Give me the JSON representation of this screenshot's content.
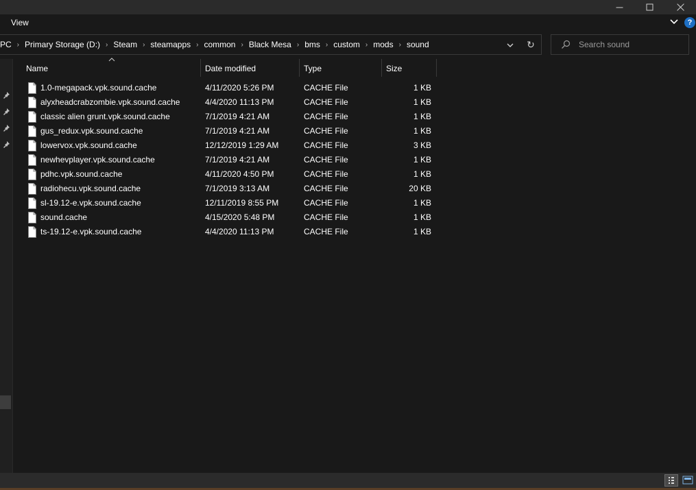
{
  "ribbon": {
    "view_tab": "View"
  },
  "address": {
    "crumbs": [
      "PC",
      "Primary Storage (D:)",
      "Steam",
      "steamapps",
      "common",
      "Black Mesa",
      "bms",
      "custom",
      "mods",
      "sound"
    ]
  },
  "search": {
    "placeholder": "Search sound"
  },
  "columns": {
    "name": "Name",
    "date": "Date modified",
    "type": "Type",
    "size": "Size"
  },
  "files": [
    {
      "name": "1.0-megapack.vpk.sound.cache",
      "date": "4/11/2020 5:26 PM",
      "type": "CACHE File",
      "size": "1 KB"
    },
    {
      "name": "alyxheadcrabzombie.vpk.sound.cache",
      "date": "4/4/2020 11:13 PM",
      "type": "CACHE File",
      "size": "1 KB"
    },
    {
      "name": "classic alien grunt.vpk.sound.cache",
      "date": "7/1/2019 4:21 AM",
      "type": "CACHE File",
      "size": "1 KB"
    },
    {
      "name": "gus_redux.vpk.sound.cache",
      "date": "7/1/2019 4:21 AM",
      "type": "CACHE File",
      "size": "1 KB"
    },
    {
      "name": "lowervox.vpk.sound.cache",
      "date": "12/12/2019 1:29 AM",
      "type": "CACHE File",
      "size": "3 KB"
    },
    {
      "name": "newhevplayer.vpk.sound.cache",
      "date": "7/1/2019 4:21 AM",
      "type": "CACHE File",
      "size": "1 KB"
    },
    {
      "name": "pdhc.vpk.sound.cache",
      "date": "4/11/2020 4:50 PM",
      "type": "CACHE File",
      "size": "1 KB"
    },
    {
      "name": "radiohecu.vpk.sound.cache",
      "date": "7/1/2019 3:13 AM",
      "type": "CACHE File",
      "size": "20 KB"
    },
    {
      "name": "sl-19.12-e.vpk.sound.cache",
      "date": "12/11/2019 8:55 PM",
      "type": "CACHE File",
      "size": "1 KB"
    },
    {
      "name": "sound.cache",
      "date": "4/15/2020 5:48 PM",
      "type": "CACHE File",
      "size": "1 KB"
    },
    {
      "name": "ts-19.12-e.vpk.sound.cache",
      "date": "4/4/2020 11:13 PM",
      "type": "CACHE File",
      "size": "1 KB"
    }
  ],
  "colors": {
    "background": "#191919",
    "chrome": "#2b2b2b",
    "help_blue": "#1e6fc4",
    "border": "#3a3a3a"
  },
  "icons": [
    "minimize-icon",
    "maximize-icon",
    "close-icon",
    "chevron-down-icon",
    "help-icon",
    "refresh-icon",
    "search-icon",
    "pin-icon",
    "file-icon",
    "sort-up-icon",
    "details-view-icon",
    "tiles-view-icon"
  ]
}
